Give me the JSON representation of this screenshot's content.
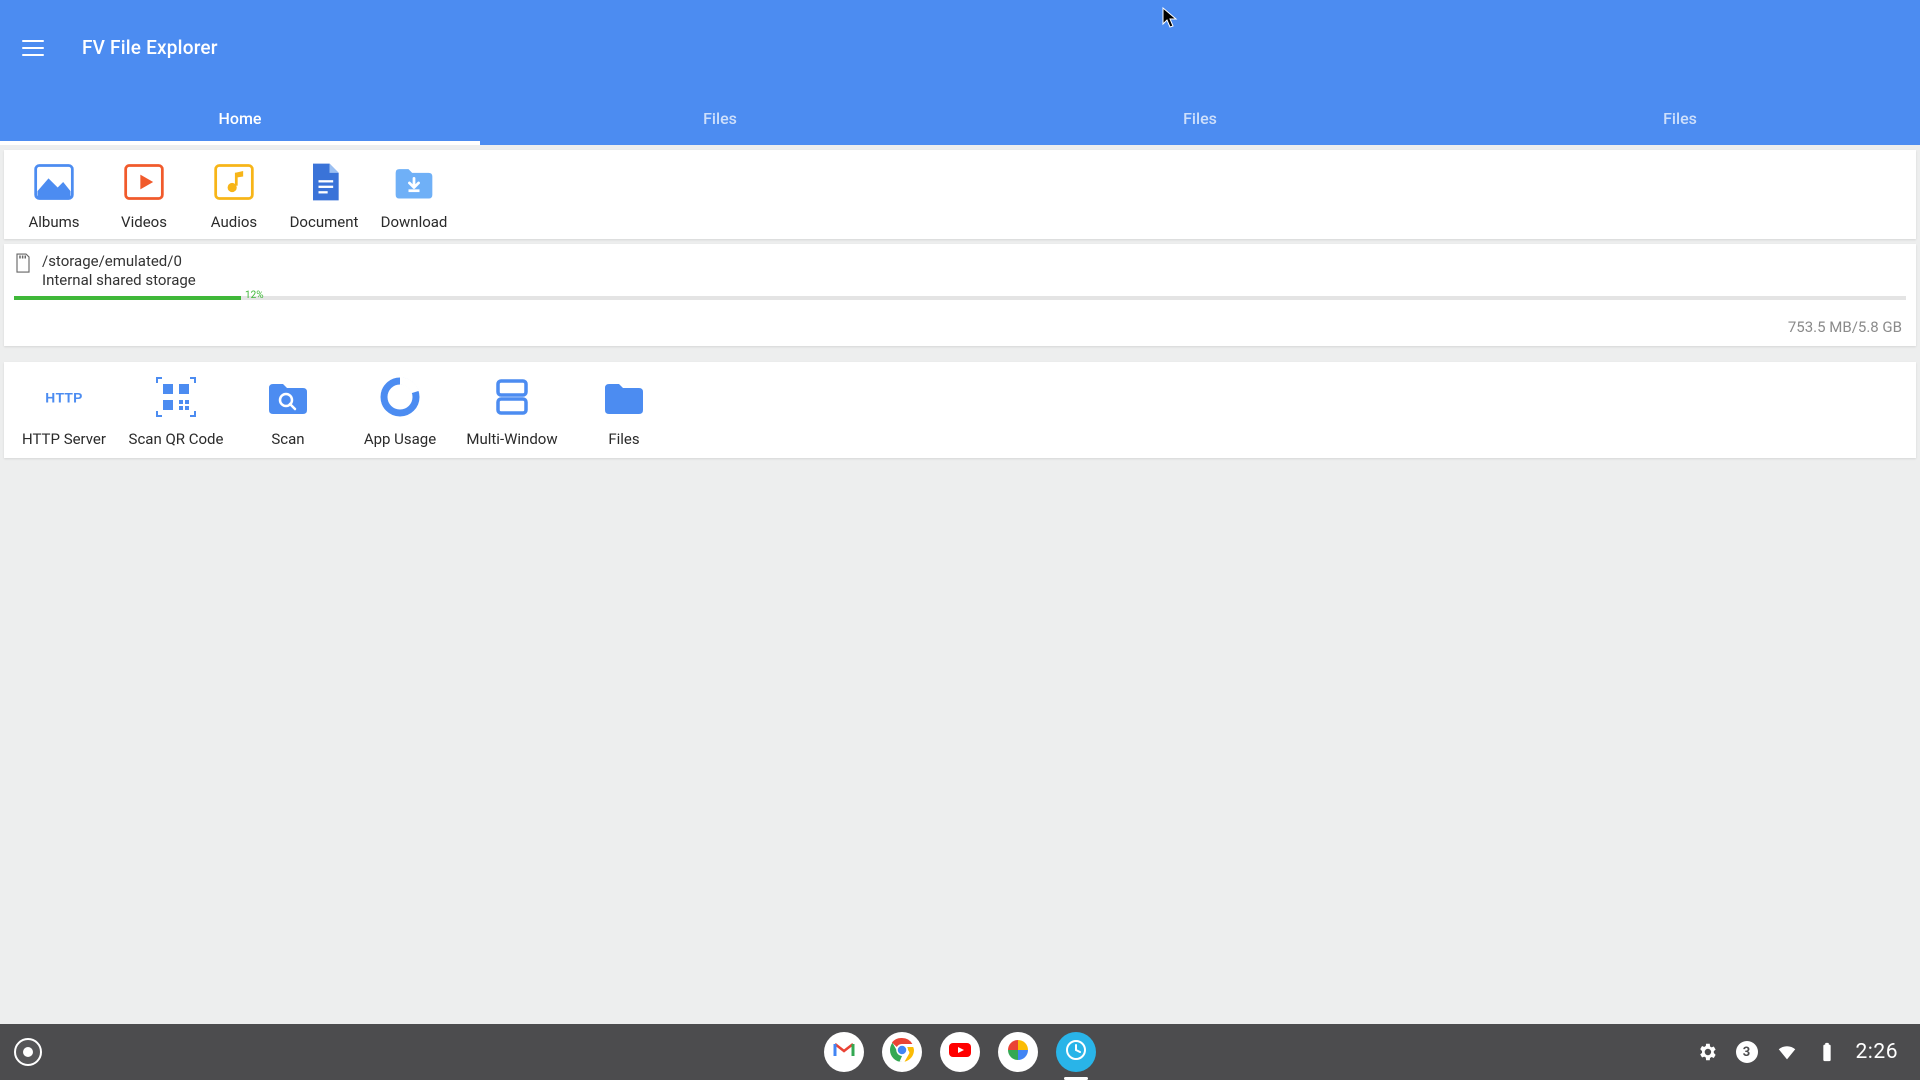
{
  "app": {
    "title": "FV File Explorer"
  },
  "tabs": [
    {
      "label": "Home",
      "active": true
    },
    {
      "label": "Files",
      "active": false
    },
    {
      "label": "Files",
      "active": false
    },
    {
      "label": "Files",
      "active": false
    }
  ],
  "categories": [
    {
      "id": "albums",
      "label": "Albums",
      "color": "#4c8cf1"
    },
    {
      "id": "videos",
      "label": "Videos",
      "color": "#f15a2b"
    },
    {
      "id": "audios",
      "label": "Audios",
      "color": "#f7b518"
    },
    {
      "id": "document",
      "label": "Document",
      "color": "#3a73d8"
    },
    {
      "id": "download",
      "label": "Download",
      "color": "#6fb0f7"
    }
  ],
  "storage": {
    "path": "/storage/emulated/0",
    "name": "Internal shared storage",
    "used_label": "753.5 MB",
    "total_label": "5.8 GB",
    "separator": "  /  ",
    "percent": 12,
    "percent_label": "12%"
  },
  "tools": [
    {
      "id": "http-server",
      "label": "HTTP Server"
    },
    {
      "id": "scan-qr",
      "label": "Scan QR Code"
    },
    {
      "id": "scan",
      "label": "Scan"
    },
    {
      "id": "app-usage",
      "label": "App Usage"
    },
    {
      "id": "multi-window",
      "label": "Multi-Window"
    },
    {
      "id": "files",
      "label": "Files"
    }
  ],
  "taskbar": {
    "notif_count": "3",
    "clock": "2:26",
    "dock": [
      {
        "id": "gmail",
        "active": false
      },
      {
        "id": "chrome",
        "active": false
      },
      {
        "id": "youtube",
        "active": false
      },
      {
        "id": "photos",
        "active": false
      },
      {
        "id": "fv",
        "active": true
      }
    ]
  },
  "colors": {
    "primary": "#4c8cf1",
    "progress": "#3fb839"
  }
}
